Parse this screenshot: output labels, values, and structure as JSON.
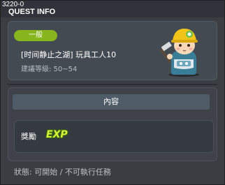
{
  "window": {
    "quest_id": "3220-0",
    "title": "QUEST INFO"
  },
  "quest": {
    "tag": "一般",
    "name": "[时间静止之湖] 玩具工人10",
    "level_text": "建議等級: 50~54",
    "portrait_icon": "toy-worker-npc-icon"
  },
  "content": {
    "header": "內容",
    "reward_label": "獎勵",
    "reward_exp": "EXP",
    "exp_icon": "exp-icon"
  },
  "status": "狀態: 可開始 / 不可執行任務",
  "colors": {
    "tag": "#86b51d",
    "exp": "#d9f23c",
    "helmet": "#f0c419"
  }
}
